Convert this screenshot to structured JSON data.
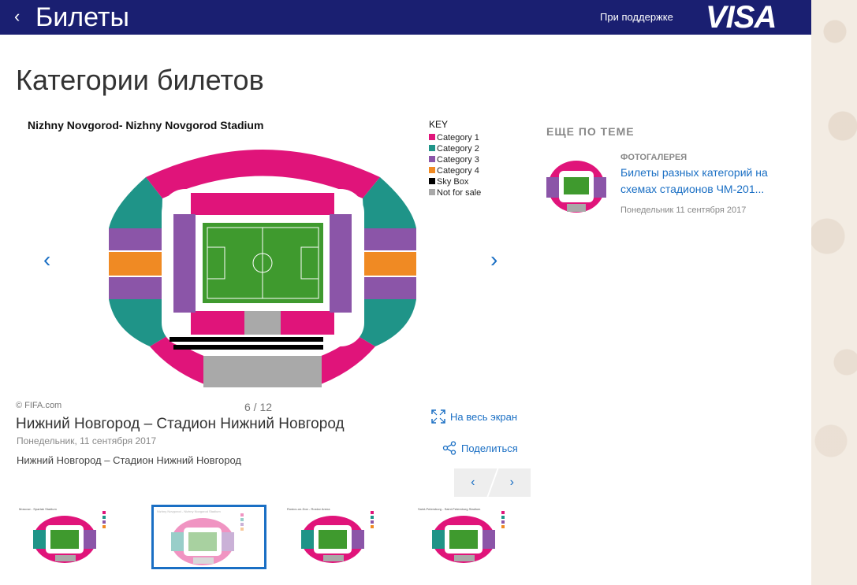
{
  "header": {
    "title": "Билеты",
    "sponsor_text": "При поддержке",
    "brand": "VISA"
  },
  "page": {
    "heading": "Категории билетов"
  },
  "map": {
    "stadium_title": "Nizhny Novgorod- Nizhny Novgorod Stadium",
    "key_title": "KEY",
    "legend": [
      {
        "label": "Category 1",
        "color": "#e0147a"
      },
      {
        "label": "Category 2",
        "color": "#1f9488"
      },
      {
        "label": "Category 3",
        "color": "#8b55a8"
      },
      {
        "label": "Category 4",
        "color": "#f08a23"
      },
      {
        "label": "Sky Box",
        "color": "#000000"
      },
      {
        "label": "Not for sale",
        "color": "#a9a9a9"
      }
    ]
  },
  "gallery": {
    "copyright": "© FIFA.com",
    "counter": "6 / 12",
    "photo_title": "Нижний Новгород – Стадион Нижний Новгород",
    "photo_date": "Понедельник, 11 сентября 2017",
    "photo_desc": "Нижний Новгород – Стадион Нижний Новгород",
    "fullscreen_label": "На весь экран",
    "share_label": "Поделиться",
    "prev_label": "‹",
    "next_label": "›",
    "prev_arrow": "‹",
    "next_arrow": "›"
  },
  "thumbnails": [
    {
      "caption": "Moscow - Spartak Stadium",
      "active": false
    },
    {
      "caption": "Nizhny Novgorod - Nizhny Novgorod Stadium",
      "active": true
    },
    {
      "caption": "Rostov-on-Don - Rostov Arena",
      "active": false
    },
    {
      "caption": "Saint-Petersburg - Saint-Petersburg Stadium",
      "active": false
    }
  ],
  "related": {
    "heading": "ЕЩЕ ПО ТЕМЕ",
    "kicker": "ФОТОГАЛЕРЕЯ",
    "title": "Билеты разных категорий на схемах стадионов ЧМ-201...",
    "date": "Понедельник 11 сентября 2017"
  },
  "colors": {
    "header_bg": "#1a1f71",
    "link": "#1a6fc4",
    "pitch": "#3f9a2e"
  }
}
